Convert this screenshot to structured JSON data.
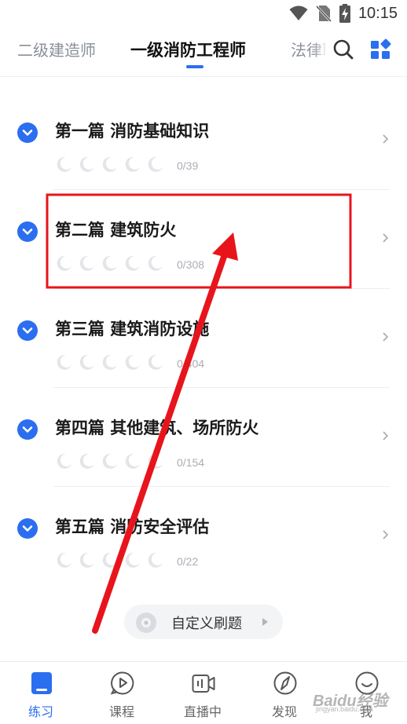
{
  "status_bar": {
    "time": "10:15",
    "icons": [
      "wifi-icon",
      "no-sim-icon",
      "battery-charging-icon"
    ]
  },
  "header": {
    "tabs": [
      {
        "label": "二级建造师",
        "active": false
      },
      {
        "label": "一级消防工程师",
        "active": true
      },
      {
        "label": "法律职",
        "active": false
      }
    ],
    "icons": [
      "search-icon",
      "grid-menu-icon"
    ],
    "accent_color": "#2b6ef0"
  },
  "chapters": [
    {
      "title": "第一篇 消防基础知识",
      "progress": "0/39"
    },
    {
      "title": "第二篇 建筑防火",
      "progress": "0/308"
    },
    {
      "title": "第三篇 建筑消防设施",
      "progress": "0/404"
    },
    {
      "title": "第四篇 其他建筑、场所防火",
      "progress": "0/154"
    },
    {
      "title": "第五篇 消防安全评估",
      "progress": "0/22"
    }
  ],
  "custom_practice": {
    "label": "自定义刷题"
  },
  "bottom_nav": [
    {
      "label": "练习",
      "icon": "book-icon",
      "active": true
    },
    {
      "label": "课程",
      "icon": "play-bubble-icon",
      "active": false
    },
    {
      "label": "直播中",
      "icon": "live-camera-icon",
      "active": false
    },
    {
      "label": "发现",
      "icon": "compass-icon",
      "active": false
    },
    {
      "label": "我",
      "icon": "smile-icon",
      "active": false
    }
  ],
  "annotations": {
    "highlight_color": "#e8141c",
    "arrow_color": "#e8141c"
  },
  "watermark": {
    "text": "Baidu经验",
    "sub": "jingyan.baidu.com"
  }
}
